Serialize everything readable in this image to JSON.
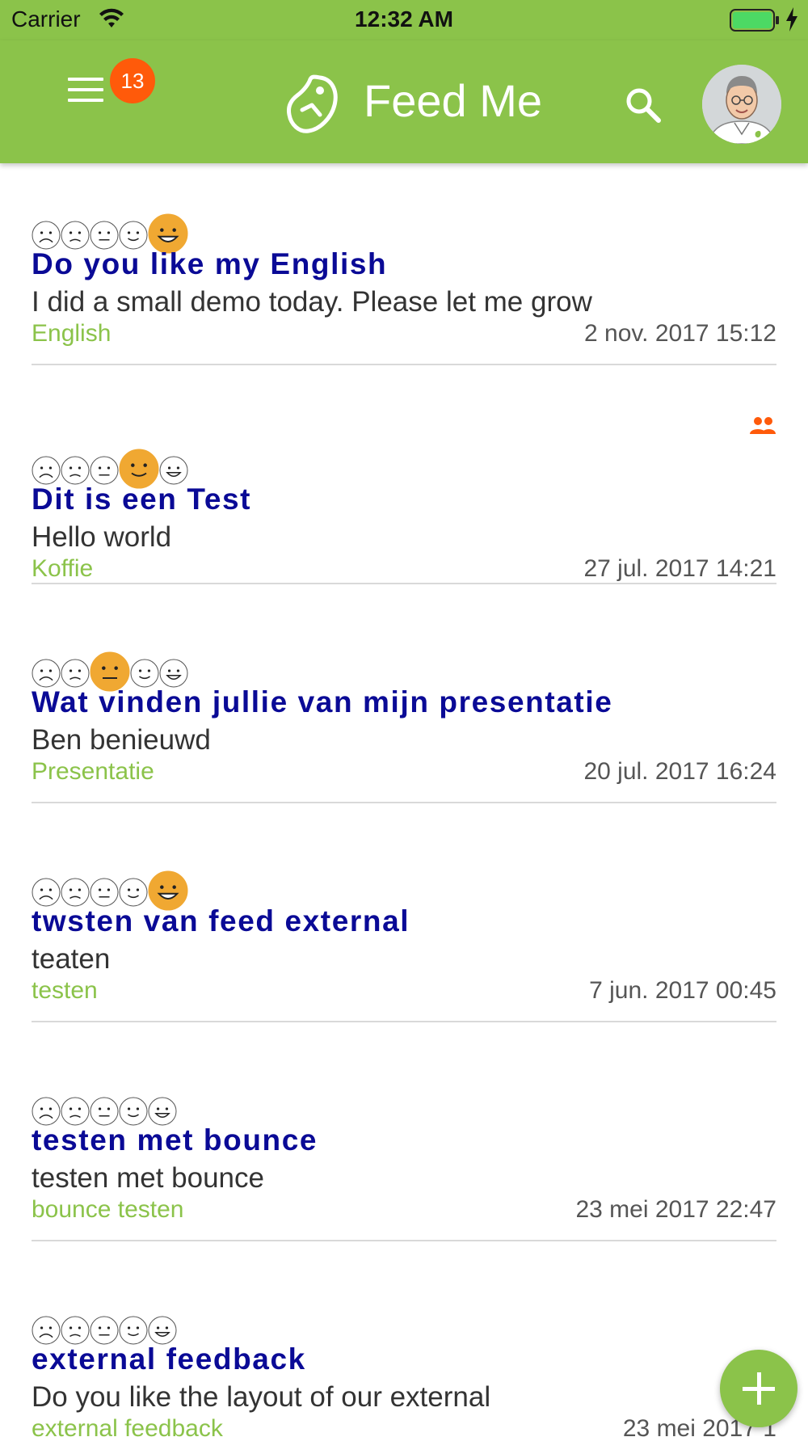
{
  "status_bar": {
    "carrier": "Carrier",
    "time": "12:32 AM"
  },
  "app_bar": {
    "title": "Feed Me",
    "badge_count": "13",
    "brand_color": "#8bc34a",
    "badge_color": "#ff5a0a",
    "menu_icon": "hamburger-menu-icon",
    "search_icon": "search-icon"
  },
  "rating_scale": [
    "very-unhappy",
    "unhappy",
    "neutral",
    "happy",
    "very-happy"
  ],
  "feeds": [
    {
      "title": "Do you like my English",
      "description": "I did a small demo today. Please let me grow",
      "tag": "English",
      "date": "2 nov. 2017 15:12",
      "selected_rating": 5,
      "group": false
    },
    {
      "title": "Dit is een Test",
      "description": "Hello world",
      "tag": "Koffie",
      "date": "27 jul. 2017 14:21",
      "selected_rating": 4,
      "group": true
    },
    {
      "title": "Wat vinden jullie van mijn presentatie",
      "description": "Ben benieuwd",
      "tag": "Presentatie",
      "date": "20 jul. 2017 16:24",
      "selected_rating": 3,
      "group": false
    },
    {
      "title": "twsten van feed external",
      "description": "teaten",
      "tag": "testen",
      "date": "7 jun. 2017 00:45",
      "selected_rating": 5,
      "group": false
    },
    {
      "title": "testen met bounce",
      "description": "testen met bounce",
      "tag": "bounce testen",
      "date": "23 mei 2017 22:47",
      "selected_rating": 0,
      "group": false
    },
    {
      "title": "external feedback",
      "description": "Do you like the layout of our external",
      "tag": "external feedback",
      "date": "23 mei 2017 1",
      "selected_rating": 0,
      "group": false
    }
  ],
  "colors": {
    "title": "#0a0a96",
    "tag": "#8bc34a",
    "selected_face": "#f0a832",
    "group_icon": "#ff5a0a"
  }
}
